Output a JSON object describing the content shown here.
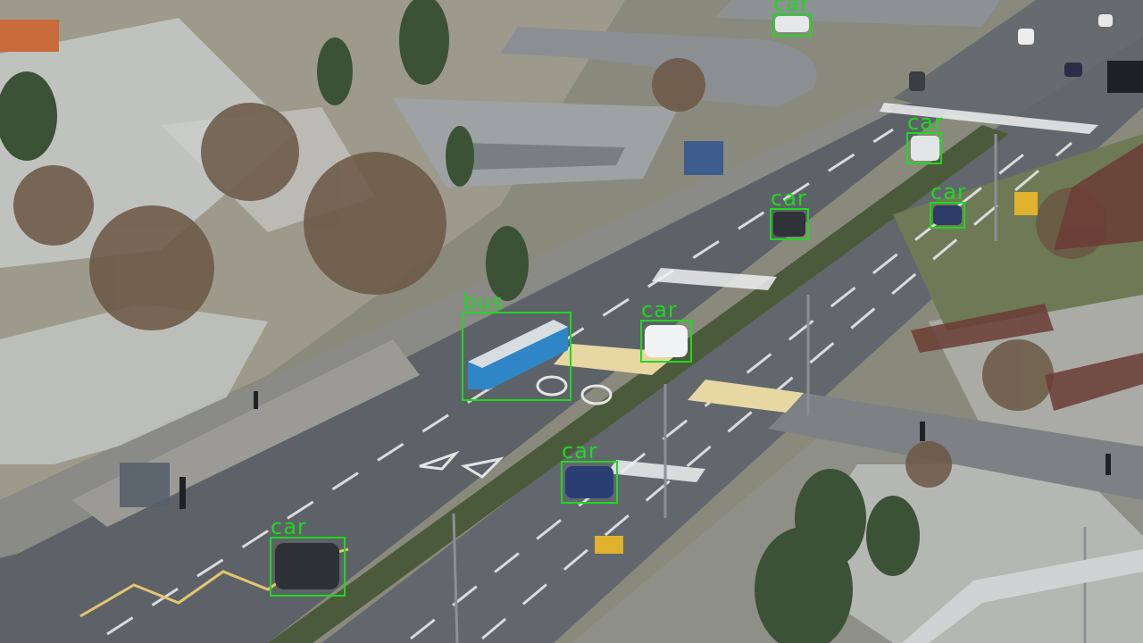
{
  "image": {
    "description": "aerial view of a divided urban road with crosswalks, bus stop, park with bare trees and light snow",
    "label_color": "#1fd81f"
  },
  "detections": [
    {
      "id": "car-1",
      "label": "car"
    },
    {
      "id": "car-2",
      "label": "car"
    },
    {
      "id": "car-3",
      "label": "car"
    },
    {
      "id": "car-4",
      "label": "car"
    },
    {
      "id": "bus-1",
      "label": "bus"
    },
    {
      "id": "car-5",
      "label": "car"
    },
    {
      "id": "car-6",
      "label": "car"
    },
    {
      "id": "car-7",
      "label": "car"
    }
  ]
}
